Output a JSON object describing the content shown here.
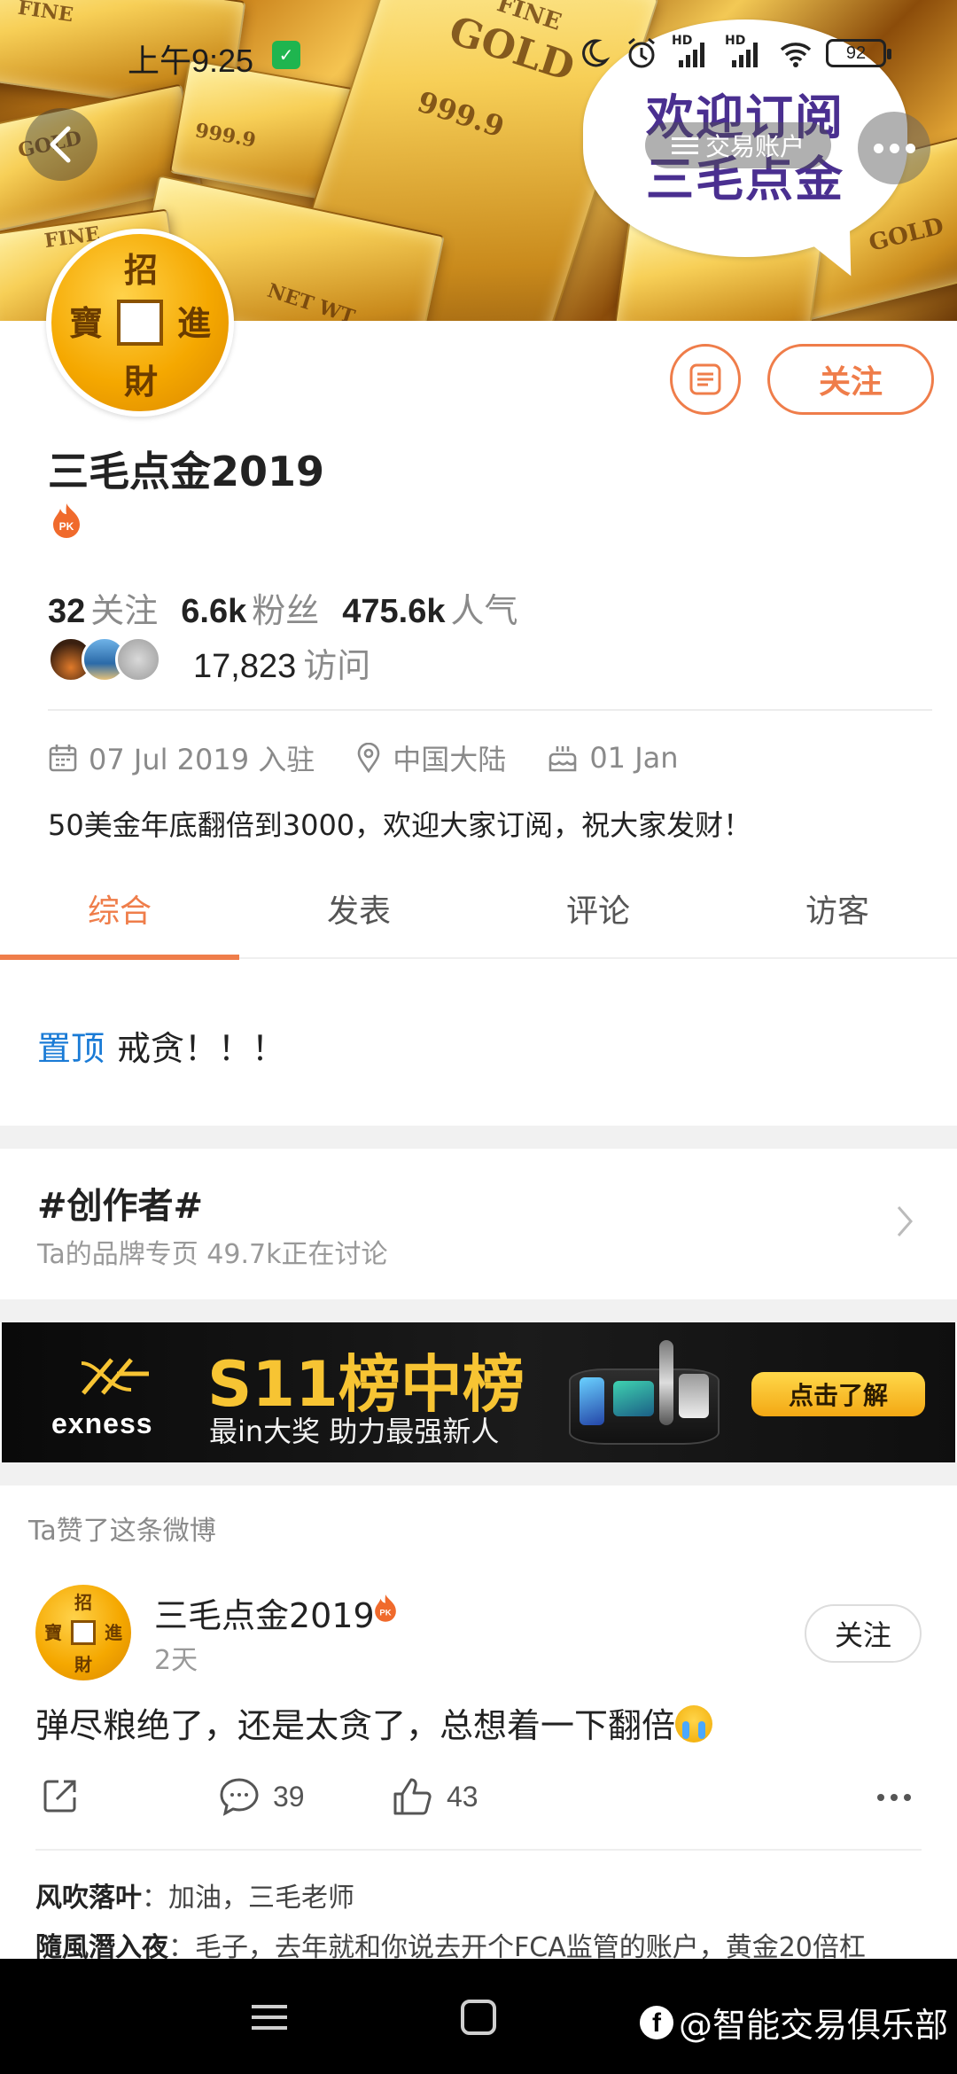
{
  "status_bar": {
    "time": "上午9:25",
    "battery": "92",
    "network_labels": [
      "HD",
      "HD"
    ]
  },
  "banner": {
    "bubble_lines": [
      "欢迎订阅",
      "三毛点金"
    ],
    "account_pill": "交易账户",
    "gold_bar_labels": [
      "FINE",
      "GOLD",
      "999.9",
      "FINE",
      "NET WT",
      "FINE",
      "GOLD",
      "GOLD",
      "999.9"
    ]
  },
  "avatar": {
    "chars": [
      "招",
      "進",
      "財",
      "寶"
    ]
  },
  "profile": {
    "follow_label": "关注",
    "name": "三毛点金2019",
    "stats": [
      {
        "value": "32",
        "label": "关注"
      },
      {
        "value": "6.6k",
        "label": "粉丝"
      },
      {
        "value": "475.6k",
        "label": "人气"
      }
    ],
    "visits_value": "17,823",
    "visits_label": "访问",
    "joined": "07 Jul 2019 入驻",
    "location": "中国大陆",
    "birthday": "01 Jan",
    "bio": "50美金年底翻倍到3000，欢迎大家订阅，祝大家发财！"
  },
  "tabs": [
    {
      "label": "综合",
      "active": true
    },
    {
      "label": "发表",
      "active": false
    },
    {
      "label": "评论",
      "active": false
    },
    {
      "label": "访客",
      "active": false
    }
  ],
  "pinned": {
    "tag": "置顶",
    "text": "戒贪！！！"
  },
  "topic": {
    "title": "#创作者#",
    "subtitle": "Ta的品牌专页  49.7k正在讨论"
  },
  "ad": {
    "logo": "exness",
    "title": "S11榜中榜",
    "subtitle": "最in大奖 助力最强新人",
    "cta": "点击了解"
  },
  "post": {
    "liked_label": "Ta赞了这条微博",
    "author": "三毛点金2019",
    "time": "2天",
    "follow_label": "关注",
    "text": "弹尽粮绝了，还是太贪了，总想着一下翻倍",
    "comments_count": "39",
    "likes_count": "43",
    "comments": [
      {
        "user": "风吹落叶",
        "text": "：加油，三毛老师"
      },
      {
        "user": "隨風潛入夜",
        "text": "：毛子，去年就和你说去开个FCA监管的账户，黄金20倍杠"
      }
    ]
  },
  "watermark": "@智能交易俱乐部",
  "colors": {
    "accent": "#ef7d4a",
    "link_blue": "#1a7bd6",
    "ad_gold": "#f7c433"
  }
}
